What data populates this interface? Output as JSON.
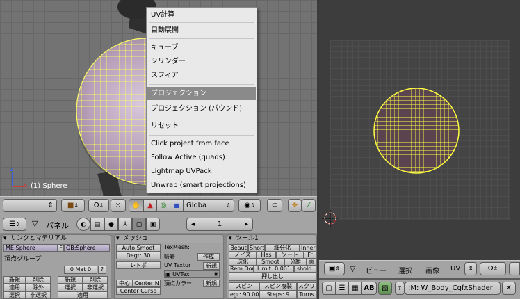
{
  "viewport3d": {
    "object_label": "(1) Sphere"
  },
  "menu": {
    "items": [
      {
        "label": "UV計算"
      },
      {
        "label": "自動展開"
      },
      {
        "label": "キューブ"
      },
      {
        "label": "シリンダー"
      },
      {
        "label": "スフィア"
      },
      {
        "label": "プロジェクション"
      },
      {
        "label": "プロジェクション (バウンド)"
      },
      {
        "label": "リセット"
      },
      {
        "label": "Click project from face"
      },
      {
        "label": "Follow Active (quads)"
      },
      {
        "label": "Lightmap UVPack"
      },
      {
        "label": "Unwrap (smart projections)"
      }
    ],
    "selected_index": 5
  },
  "toolbar3d": {
    "orientation": "Globa"
  },
  "buttons_window": {
    "panel_label": "パネル",
    "frame": "1",
    "link_panel": {
      "title": "リンクとマテリアル",
      "mesh_name": "ME:Sphere",
      "f_label": "F",
      "ob_name": "OB:Sphere",
      "vgroup_label": "頂点グループ",
      "mat_label": "0 Mat 0",
      "mat_q": "?",
      "b_new": "新規",
      "b_delete": "削除",
      "b_assign": "適用",
      "b_remove": "除外",
      "b_select": "選択",
      "b_deselect": "非選択",
      "b_new2": "新規",
      "b_delete2": "削除",
      "b_select2": "選択",
      "b_deselect2": "非選択",
      "b_assign2": "適用"
    },
    "mesh_panel": {
      "title": "メッシュ",
      "auto_smooth": "Auto Smoot",
      "degr": "Degr: 30",
      "retopo": "レトポ",
      "center": "中心",
      "center_new": "Center N",
      "center_cursor": "Center Curso",
      "texmesh": "TexMesh:",
      "sticky": "吸着",
      "sticky_btn": "作成",
      "uv_texture": "UV Textur",
      "uv_new": "新規",
      "uvtex": "UVTex",
      "vcol": "頂点カラー",
      "vcol_new": "新規"
    },
    "tools_panel": {
      "title": "ツール1",
      "beauty": "Beaut",
      "short": "Short",
      "subdivide": "細分化",
      "inner": "Inner",
      "noise": "ノイズ",
      "hash": "Has",
      "sort": "ソート",
      "fr": "Fr",
      "to_sphere": "球化",
      "smooth": "Smoot",
      "split": "分離",
      "face": "面",
      "rem_doubles": "Rem Dou",
      "limit": "Limit: 0.001",
      "threshold": "shold:",
      "extrude": "押し出し",
      "spin": "スピン",
      "spin_dup": "スピン複製",
      "screw": "スクリ",
      "degr": "egr: 90.00",
      "steps": "Steps: 9",
      "turns": "Turns"
    }
  },
  "uv_header": {
    "view": "ビュー",
    "select": "選択",
    "image": "画像",
    "uvs": "UV"
  },
  "bottom_bar": {
    "ab": "AB",
    "material": ":M: W_Body_CgfxShader"
  },
  "colors": {
    "menu_highlight": "#8a8a8a",
    "mesh_wire": "#ffff60",
    "uv_wire": "#ffff40"
  }
}
